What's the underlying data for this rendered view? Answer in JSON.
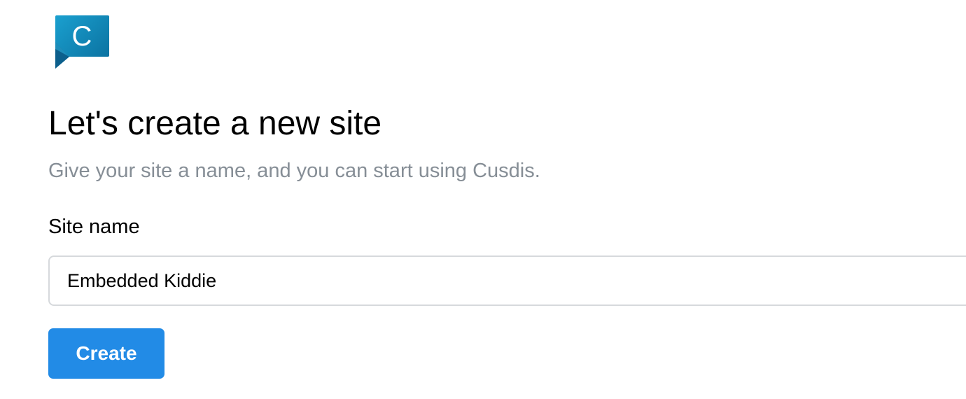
{
  "brand": {
    "logo_letter": "C",
    "logo_icon": "cusdis-logo-icon",
    "colors": {
      "logo_top": "#1a98c6",
      "logo_bottom": "#0a6f9e",
      "logo_fold": "#0d5f8a"
    }
  },
  "page": {
    "title": "Let's create a new site",
    "subtitle": "Give your site a name, and you can start using Cusdis."
  },
  "form": {
    "site_name_label": "Site name",
    "site_name_value": "Embedded Kiddie",
    "create_label": "Create"
  },
  "colors": {
    "subtitle": "#868e96",
    "button": "#228be6",
    "input_border": "#d6d9dc"
  }
}
